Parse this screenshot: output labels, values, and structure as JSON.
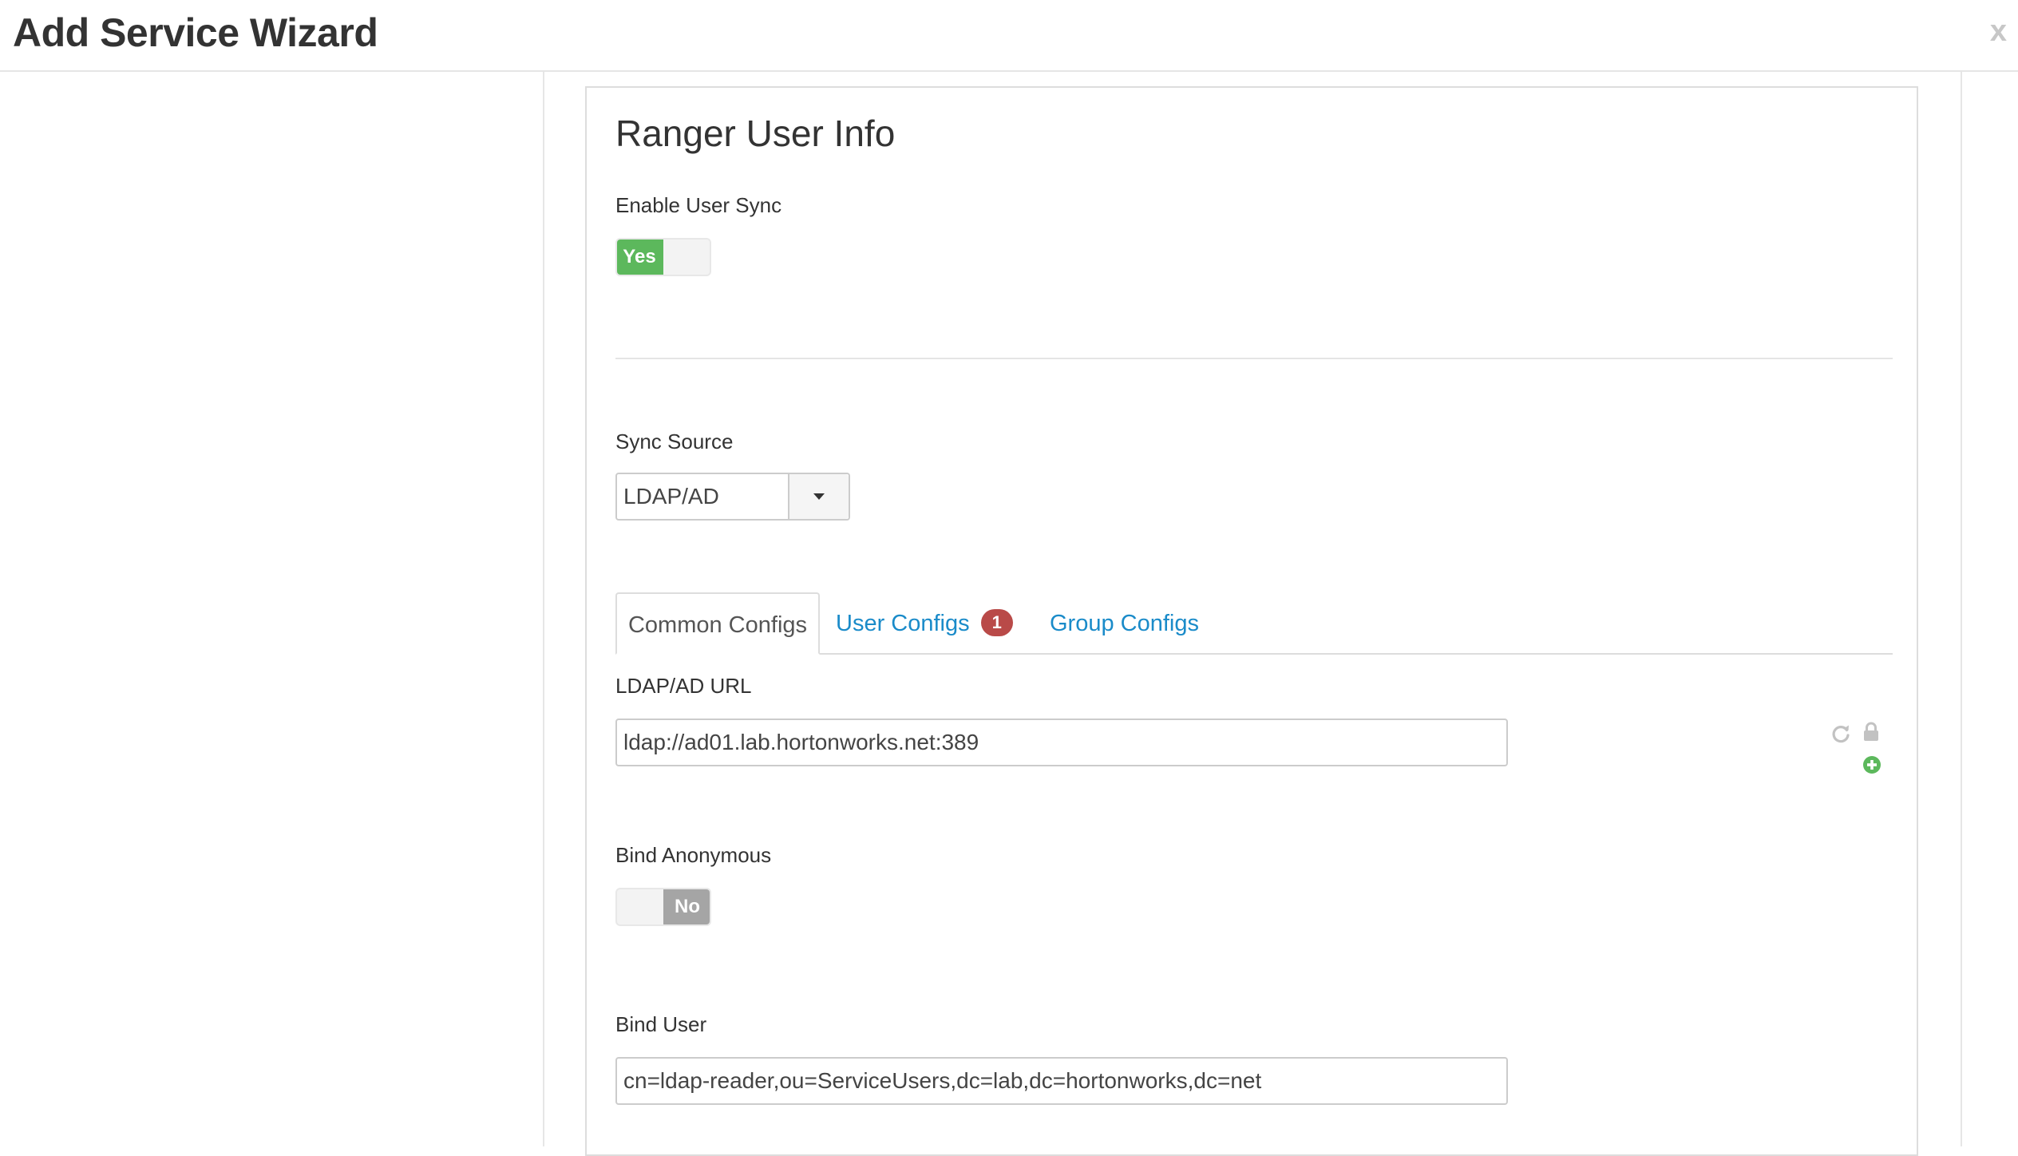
{
  "window": {
    "title": "Add Service Wizard",
    "close_label": "x"
  },
  "section": {
    "title": "Ranger User Info"
  },
  "enable_user_sync": {
    "label": "Enable User Sync",
    "value": "Yes",
    "state": "on"
  },
  "sync_source": {
    "label": "Sync Source",
    "selected": "LDAP/AD"
  },
  "tabs": [
    {
      "label": "Common Configs",
      "active": true
    },
    {
      "label": "User Configs",
      "badge": "1",
      "active": false
    },
    {
      "label": "Group Configs",
      "active": false
    }
  ],
  "ldap_url": {
    "label": "LDAP/AD URL",
    "value": "ldap://ad01.lab.hortonworks.net:389"
  },
  "bind_anonymous": {
    "label": "Bind Anonymous",
    "value": "No",
    "state": "off"
  },
  "bind_user": {
    "label": "Bind User",
    "value": "cn=ldap-reader,ou=ServiceUsers,dc=lab,dc=hortonworks,dc=net"
  },
  "icons": {
    "refresh": "refresh-icon",
    "lock": "lock-icon",
    "add": "add-circle-icon"
  },
  "colors": {
    "toggle_on": "#5cb85c",
    "toggle_off": "#a5a5a5",
    "link": "#1a8bc9",
    "badge": "#b94a48",
    "add_icon": "#5cb85c"
  }
}
